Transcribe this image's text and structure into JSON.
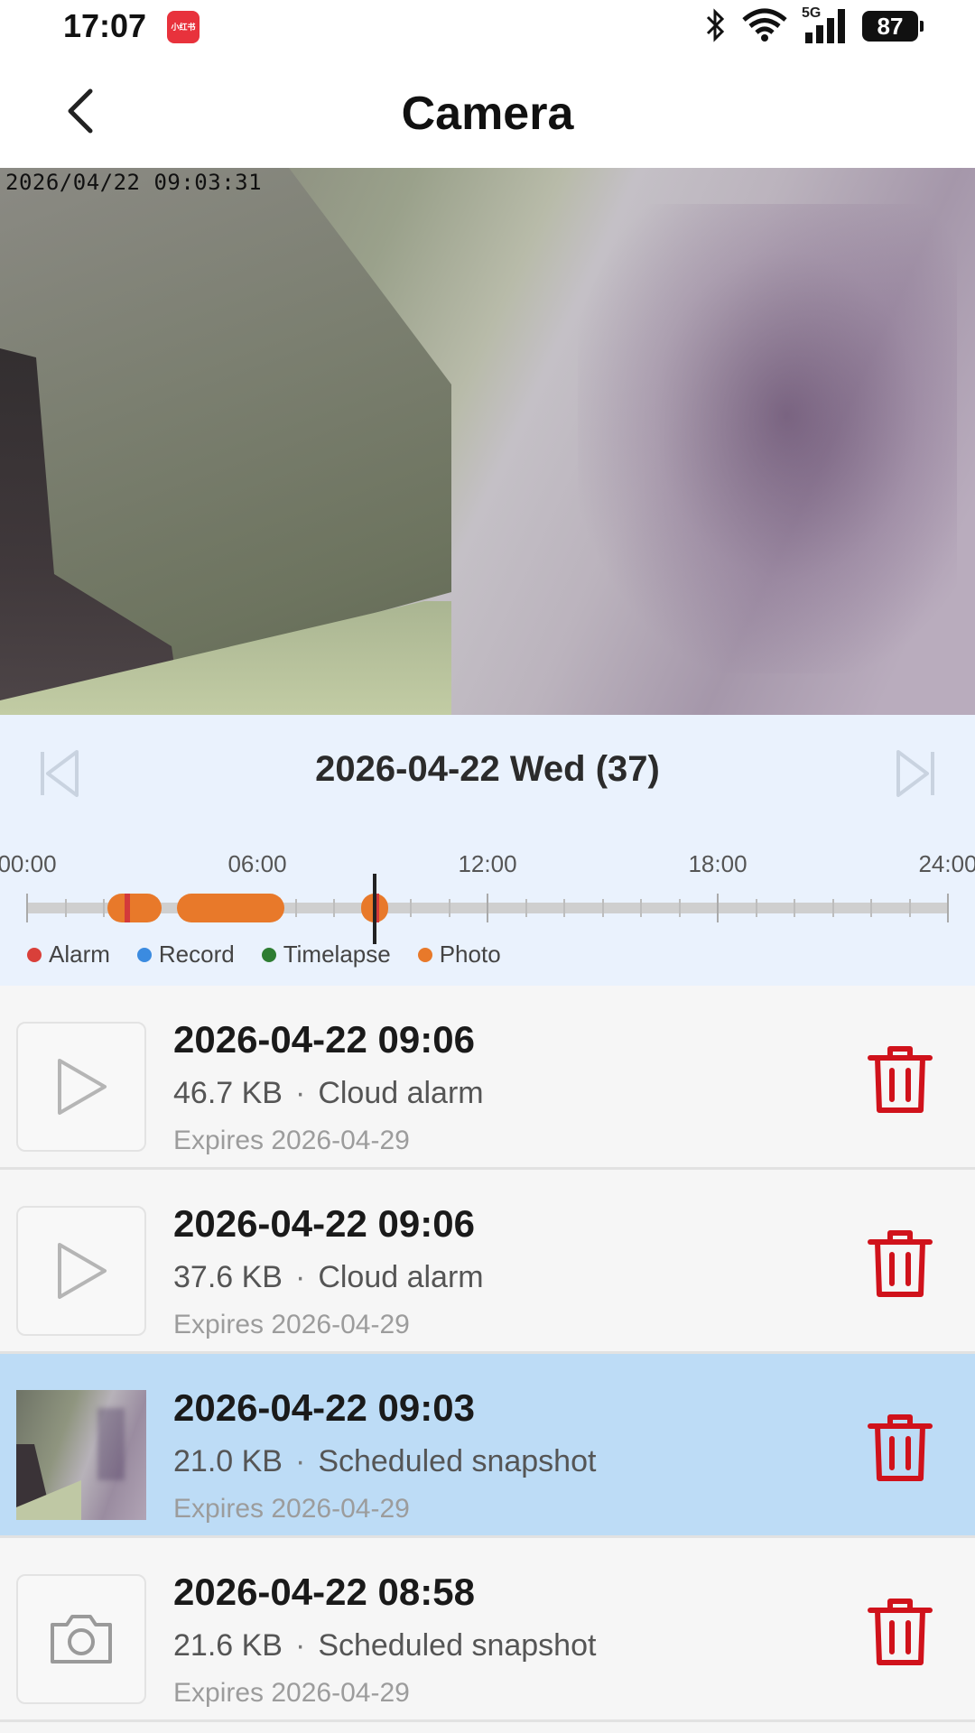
{
  "status_bar": {
    "time": "17:07",
    "app_icon_text": "小红书",
    "network": "5G",
    "battery": "87",
    "icons": [
      "bluetooth-icon",
      "wifi-icon",
      "signal-icon",
      "battery-icon"
    ]
  },
  "header": {
    "title": "Camera",
    "back_icon": "chevron-left-icon"
  },
  "camera": {
    "timestamp": "2026/04/22 09:03:31"
  },
  "date_nav": {
    "label": "2026-04-22 Wed (37)",
    "prev_icon": "skip-previous-icon",
    "next_icon": "skip-next-icon"
  },
  "timeline": {
    "hour_labels": [
      "00:00",
      "06:00",
      "12:00",
      "18:00",
      "24:00"
    ],
    "hour_range": [
      0,
      24
    ],
    "photo_segments": [
      [
        2.1,
        3.5
      ],
      [
        3.9,
        6.7
      ],
      [
        8.7,
        9.4
      ]
    ],
    "alarm_marks": [
      2.6,
      9.1
    ],
    "cursor_hour": 9.05,
    "colors": {
      "photo": "#e8792a",
      "alarm": "#d33a3a",
      "cursor": "#222222"
    }
  },
  "legend": [
    {
      "label": "Alarm",
      "color": "#d9403a"
    },
    {
      "label": "Record",
      "color": "#3b8be0"
    },
    {
      "label": "Timelapse",
      "color": "#2e7d32"
    },
    {
      "label": "Photo",
      "color": "#e8792a"
    }
  ],
  "records": [
    {
      "title": "2026-04-22 09:06",
      "size": "46.7 KB",
      "separator": "·",
      "kind": "Cloud alarm",
      "expires": "Expires 2026-04-29",
      "thumb": "play-icon",
      "selected": false
    },
    {
      "title": "2026-04-22 09:06",
      "size": "37.6 KB",
      "separator": "·",
      "kind": "Cloud alarm",
      "expires": "Expires 2026-04-29",
      "thumb": "play-icon",
      "selected": false
    },
    {
      "title": "2026-04-22 09:03",
      "size": "21.0 KB",
      "separator": "·",
      "kind": "Scheduled snapshot",
      "expires": "Expires 2026-04-29",
      "thumb": "snapshot-image",
      "selected": true
    },
    {
      "title": "2026-04-22 08:58",
      "size": "21.6 KB",
      "separator": "·",
      "kind": "Scheduled snapshot",
      "expires": "Expires 2026-04-29",
      "thumb": "camera-icon",
      "selected": false
    }
  ],
  "colors": {
    "accent_red": "#d0121b",
    "selected_row": "#bddcf6",
    "date_panel_bg": "#eaf2fd"
  }
}
